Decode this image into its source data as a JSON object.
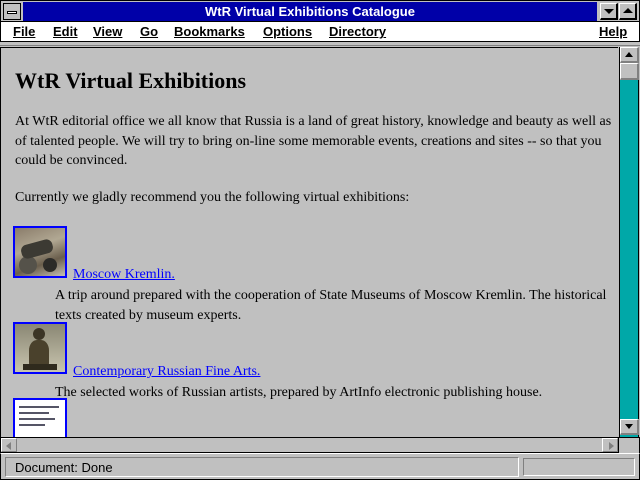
{
  "window": {
    "title": "WtR Virtual Exhibitions Catalogue"
  },
  "menu": {
    "items": [
      "File",
      "Edit",
      "View",
      "Go",
      "Bookmarks",
      "Options",
      "Directory",
      "Help"
    ]
  },
  "page": {
    "heading": "WtR Virtual Exhibitions",
    "intro": "At WtR editorial office we all know that Russia is a land of great history, knowledge and beauty as well as of talented people. We will try to bring on-line some memorable events, creations and sites -- so that you could be convinced.",
    "recommend": "Currently we gladly recommend you the following virtual exhibitions:",
    "exhibitions": [
      {
        "link": "Moscow Kremlin.",
        "description": "A trip around prepared with the cooperation of State Museums of Moscow Kremlin. The historical texts created by museum experts."
      },
      {
        "link": "Contemporary Russian Fine Arts.",
        "description": "The selected works of Russian artists, prepared by ArtInfo electronic publishing house."
      }
    ]
  },
  "status": {
    "text": "Document: Done"
  },
  "colors": {
    "title_bar": "#0000a8",
    "link": "#0000ff",
    "scroll_track": "#00a8a8",
    "background": "#c0c0c0"
  }
}
